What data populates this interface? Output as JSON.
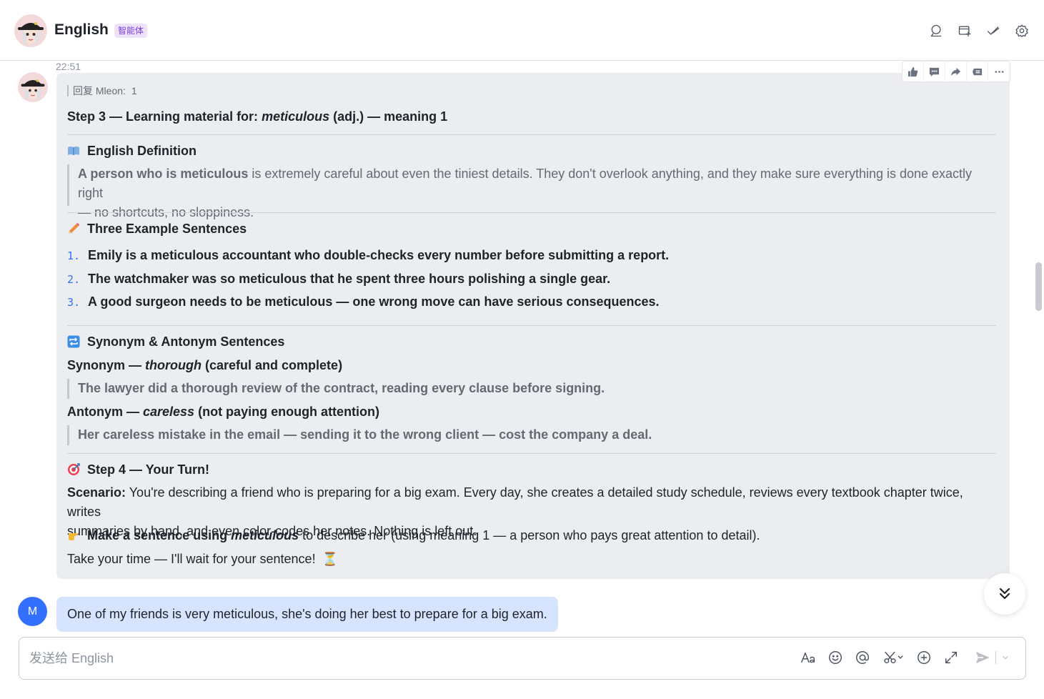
{
  "header": {
    "title": "English",
    "badge": "智能体"
  },
  "message": {
    "time": "22:51",
    "reply_label": "回复 Mleon:",
    "reply_text": "1",
    "step3": {
      "prefix": "Step 3 — Learning material for: ",
      "word": "meticulous",
      "suffix": " (adj.) — meaning 1"
    },
    "definition": {
      "heading": "English Definition",
      "lead": "A person who is meticulous",
      "body_line1": " is extremely careful about even the tiniest details. They don't overlook anything, and they make sure everything is done exactly right",
      "body_line2": "— no shortcuts, no sloppiness."
    },
    "examples": {
      "heading": "Three Example Sentences",
      "items": [
        {
          "num": "1.",
          "text": "Emily is a meticulous accountant who double-checks every number before submitting a report."
        },
        {
          "num": "2.",
          "text": "The watchmaker was so meticulous that he spent three hours polishing a single gear."
        },
        {
          "num": "3.",
          "text": "A good surgeon needs to be meticulous — one wrong move can have serious consequences."
        }
      ]
    },
    "synant": {
      "heading": "Synonym & Antonym Sentences",
      "syn_label": "Synonym — ",
      "syn_word": "thorough",
      "syn_meaning": " (careful and complete)",
      "syn_sentence": "The lawyer did a thorough review of the contract, reading every clause before signing.",
      "ant_label": "Antonym — ",
      "ant_word": "careless",
      "ant_meaning": " (not paying enough attention)",
      "ant_sentence": "Her careless mistake in the email — sending it to the wrong client — cost the company a deal."
    },
    "step4": {
      "heading": "Step 4 — Your Turn!",
      "scenario_label": "Scenario:",
      "scenario_line1": " You're describing a friend who is preparing for a big exam. Every day, she creates a detailed study schedule, reviews every textbook chapter twice, writes",
      "scenario_line2": "summaries by hand, and even color-codes her notes. Nothing is left out.",
      "task_bold": "Make a sentence using ",
      "task_word": "meticulous",
      "task_rest": " to describe her (using meaning 1 — a person who pays great attention to detail).",
      "closing": "Take your time — I'll wait for your sentence!",
      "closing_emoji": "⏳"
    }
  },
  "user_message": {
    "avatar_letter": "M",
    "text": "One of my friends is very meticulous, she's doing her best to prepare for a big exam."
  },
  "composer": {
    "placeholder": "发送给 English"
  },
  "colors": {
    "accent": "#3370ff",
    "bot_bubble": "#ebedf0",
    "user_bubble": "#d6e4ff",
    "badge_bg": "#ece3fb",
    "badge_text": "#7c3fd8"
  },
  "icons": {
    "header": [
      "search-icon",
      "add-tab-icon",
      "check-icon",
      "settings-icon"
    ],
    "message_toolbar": [
      "thumbs-up-icon",
      "comment-icon",
      "forward-icon",
      "quote-icon",
      "more-icon"
    ],
    "composer": [
      "font-format-icon",
      "emoji-icon",
      "mention-icon",
      "scissors-icon",
      "add-icon",
      "expand-icon",
      "send-icon"
    ]
  }
}
